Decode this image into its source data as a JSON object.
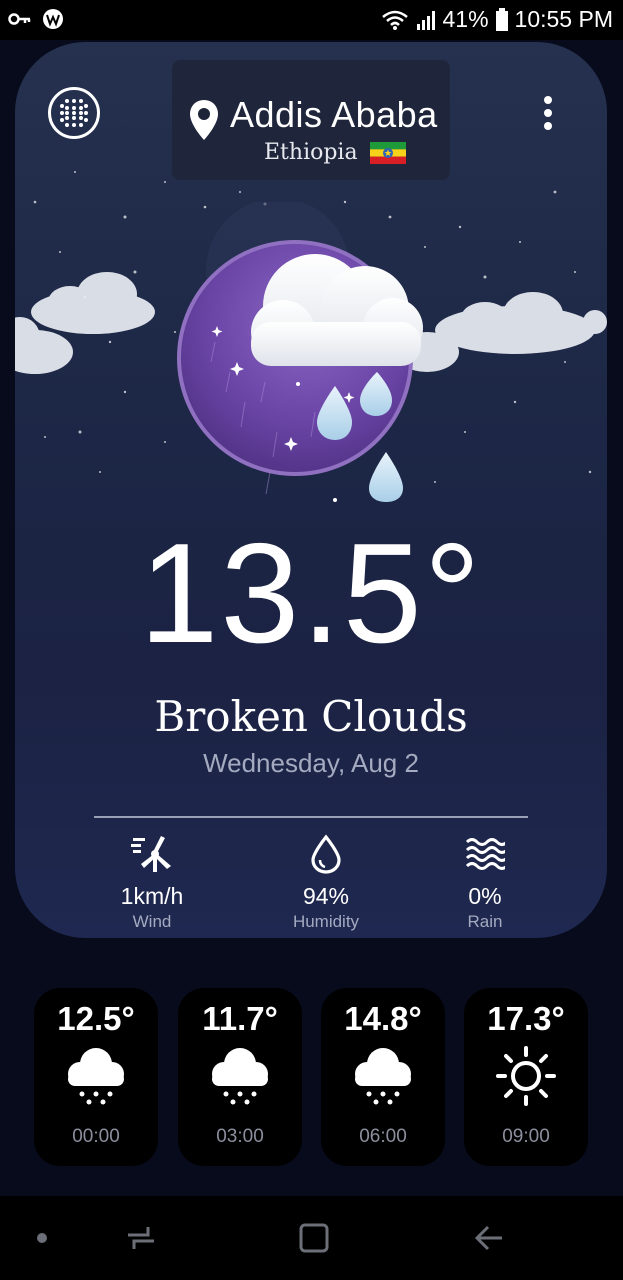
{
  "status_bar": {
    "battery": "41%",
    "time": "10:55 PM"
  },
  "location": {
    "city": "Addis Ababa",
    "country": "Ethiopia"
  },
  "current": {
    "temperature": "13.5°",
    "condition": "Broken Clouds",
    "date": "Wednesday, Aug 2"
  },
  "stats": [
    {
      "value": "1km/h",
      "label": "Wind",
      "icon": "wind-turbine-icon"
    },
    {
      "value": "94%",
      "label": "Humidity",
      "icon": "droplet-icon"
    },
    {
      "value": "0%",
      "label": "Rain",
      "icon": "waves-icon"
    }
  ],
  "forecast": [
    {
      "temp": "12.5°",
      "hour": "00:00",
      "icon": "snow-cloud-icon"
    },
    {
      "temp": "11.7°",
      "hour": "03:00",
      "icon": "snow-cloud-icon"
    },
    {
      "temp": "14.8°",
      "hour": "06:00",
      "icon": "snow-cloud-icon"
    },
    {
      "temp": "17.3°",
      "hour": "09:00",
      "icon": "sun-icon"
    }
  ],
  "colors": {
    "card": "#1d2746",
    "orb": "#6e4aa8",
    "flag_green": "#1f9a3a",
    "flag_yellow": "#f6d31a",
    "flag_red": "#d81f26",
    "flag_emblem": "#2f63b8"
  }
}
